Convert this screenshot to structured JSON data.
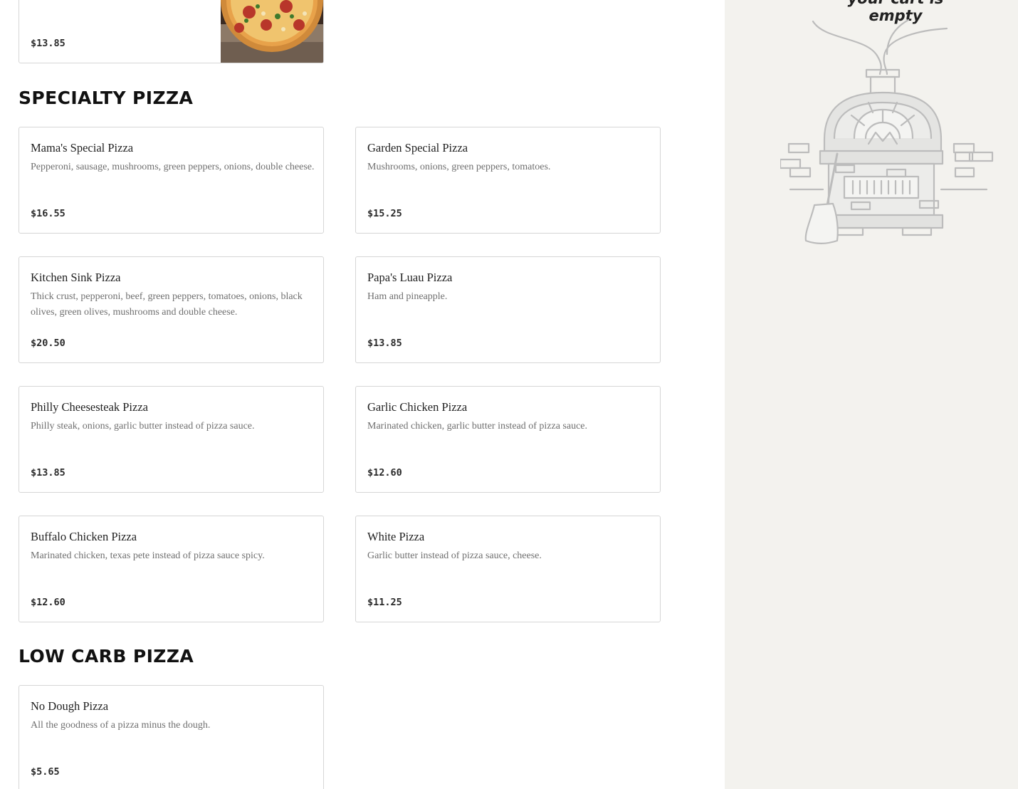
{
  "cart": {
    "empty_message": "your cart is empty"
  },
  "top_card": {
    "price": "$13.85"
  },
  "sections": {
    "specialty": {
      "title": "SPECIALTY PIZZA",
      "items": [
        {
          "name": "Mama's Special Pizza",
          "desc": "Pepperoni, sausage, mushrooms, green peppers, onions, double cheese.",
          "price": "$16.55"
        },
        {
          "name": "Garden Special Pizza",
          "desc": "Mushrooms, onions, green peppers, tomatoes.",
          "price": "$15.25"
        },
        {
          "name": "Kitchen Sink Pizza",
          "desc": "Thick crust, pepperoni, beef, green peppers, tomatoes, onions, black olives, green olives, mushrooms and double cheese.",
          "price": "$20.50"
        },
        {
          "name": "Papa's Luau Pizza",
          "desc": "Ham and pineapple.",
          "price": "$13.85"
        },
        {
          "name": "Philly Cheesesteak Pizza",
          "desc": "Philly steak, onions, garlic butter instead of pizza sauce.",
          "price": "$13.85"
        },
        {
          "name": "Garlic Chicken Pizza",
          "desc": "Marinated chicken, garlic butter instead of pizza sauce.",
          "price": "$12.60"
        },
        {
          "name": "Buffalo Chicken Pizza",
          "desc": "Marinated chicken, texas pete instead of pizza sauce spicy.",
          "price": "$12.60"
        },
        {
          "name": "White Pizza",
          "desc": "Garlic butter instead of pizza sauce, cheese.",
          "price": "$11.25"
        }
      ]
    },
    "lowcarb": {
      "title": "LOW CARB PIZZA",
      "items": [
        {
          "name": "No Dough Pizza",
          "desc": "All the goodness of a pizza minus the dough.",
          "price": "$5.65"
        }
      ]
    }
  }
}
